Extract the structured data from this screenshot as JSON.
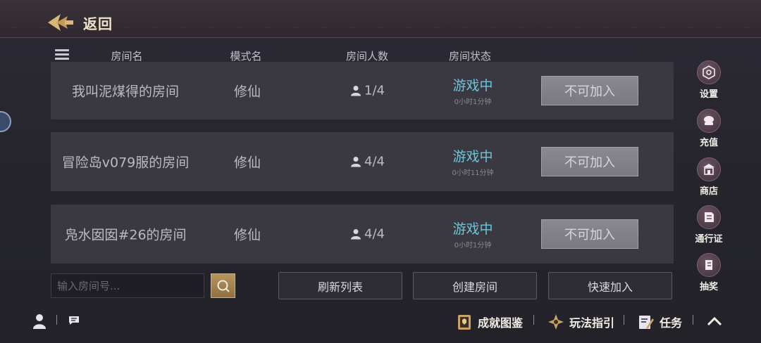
{
  "topbar": {
    "back_label": "返回"
  },
  "table": {
    "headers": {
      "room_name": "房间名",
      "mode_name": "模式名",
      "player_count": "房间人数",
      "room_status": "房间状态"
    },
    "rows": [
      {
        "room_name": "我叫泥煤得的房间",
        "mode": "修仙",
        "players": "1/4",
        "status": "游戏中",
        "duration": "0小时1分钟",
        "action": "不可加入"
      },
      {
        "room_name": "冒险岛v079服的房间",
        "mode": "修仙",
        "players": "4/4",
        "status": "游戏中",
        "duration": "0小时11分钟",
        "action": "不可加入"
      },
      {
        "room_name": "凫水囡囡#26的房间",
        "mode": "修仙",
        "players": "4/4",
        "status": "游戏中",
        "duration": "0小时1分钟",
        "action": "不可加入"
      }
    ]
  },
  "search": {
    "placeholder": "输入房间号..."
  },
  "actions": {
    "refresh": "刷新列表",
    "create": "创建房间",
    "quick_join": "快速加入"
  },
  "side_menu": [
    {
      "label": "设置",
      "icon": "settings-icon"
    },
    {
      "label": "充值",
      "icon": "recharge-icon"
    },
    {
      "label": "商店",
      "icon": "shop-icon"
    },
    {
      "label": "通行证",
      "icon": "pass-icon"
    },
    {
      "label": "抽奖",
      "icon": "lottery-icon"
    }
  ],
  "bottom_bar": {
    "achievements": "成就图鉴",
    "guide": "玩法指引",
    "tasks": "任务"
  },
  "colors": {
    "status": "#6cc6dc",
    "accent_gold": "#b8955e",
    "row_bg": "#3a3941"
  }
}
